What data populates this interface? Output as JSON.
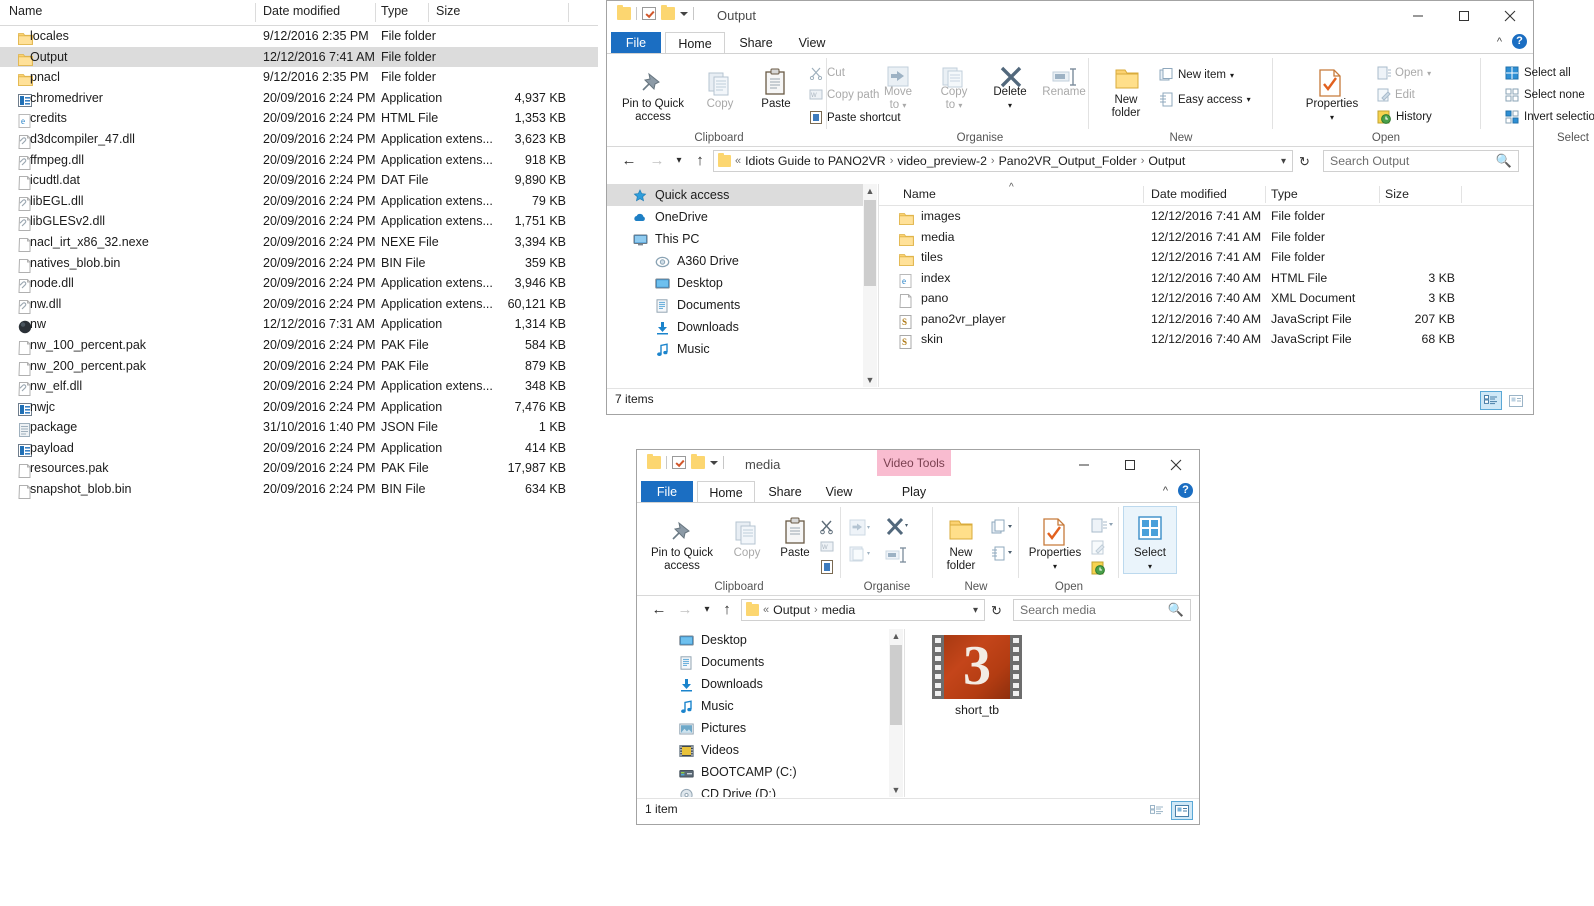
{
  "background_list": {
    "columns": [
      "Name",
      "Date modified",
      "Type",
      "Size"
    ],
    "rows": [
      {
        "icon": "folder-icon",
        "name": "locales",
        "date": "9/12/2016 2:35 PM",
        "type": "File folder",
        "size": "",
        "selected": false
      },
      {
        "icon": "folder-icon",
        "name": "Output",
        "date": "12/12/2016 7:41 AM",
        "type": "File folder",
        "size": "",
        "selected": true
      },
      {
        "icon": "folder-icon",
        "name": "pnacl",
        "date": "9/12/2016 2:35 PM",
        "type": "File folder",
        "size": "",
        "selected": false
      },
      {
        "icon": "application-icon",
        "name": "chromedriver",
        "date": "20/09/2016 2:24 PM",
        "type": "Application",
        "size": "4,937 KB",
        "selected": false
      },
      {
        "icon": "html-file-icon",
        "name": "credits",
        "date": "20/09/2016 2:24 PM",
        "type": "HTML File",
        "size": "1,353 KB",
        "selected": false
      },
      {
        "icon": "dll-icon",
        "name": "d3dcompiler_47.dll",
        "date": "20/09/2016 2:24 PM",
        "type": "Application extens...",
        "size": "3,623 KB",
        "selected": false
      },
      {
        "icon": "dll-icon",
        "name": "ffmpeg.dll",
        "date": "20/09/2016 2:24 PM",
        "type": "Application extens...",
        "size": "918 KB",
        "selected": false
      },
      {
        "icon": "generic-file-icon",
        "name": "icudtl.dat",
        "date": "20/09/2016 2:24 PM",
        "type": "DAT File",
        "size": "9,890 KB",
        "selected": false
      },
      {
        "icon": "dll-icon",
        "name": "libEGL.dll",
        "date": "20/09/2016 2:24 PM",
        "type": "Application extens...",
        "size": "79 KB",
        "selected": false
      },
      {
        "icon": "dll-icon",
        "name": "libGLESv2.dll",
        "date": "20/09/2016 2:24 PM",
        "type": "Application extens...",
        "size": "1,751 KB",
        "selected": false
      },
      {
        "icon": "generic-file-icon",
        "name": "nacl_irt_x86_32.nexe",
        "date": "20/09/2016 2:24 PM",
        "type": "NEXE File",
        "size": "3,394 KB",
        "selected": false
      },
      {
        "icon": "generic-file-icon",
        "name": "natives_blob.bin",
        "date": "20/09/2016 2:24 PM",
        "type": "BIN File",
        "size": "359 KB",
        "selected": false
      },
      {
        "icon": "dll-icon",
        "name": "node.dll",
        "date": "20/09/2016 2:24 PM",
        "type": "Application extens...",
        "size": "3,946 KB",
        "selected": false
      },
      {
        "icon": "dll-icon",
        "name": "nw.dll",
        "date": "20/09/2016 2:24 PM",
        "type": "Application extens...",
        "size": "60,121 KB",
        "selected": false
      },
      {
        "icon": "nw-app-icon",
        "name": "nw",
        "date": "12/12/2016 7:31 AM",
        "type": "Application",
        "size": "1,314 KB",
        "selected": false
      },
      {
        "icon": "generic-file-icon",
        "name": "nw_100_percent.pak",
        "date": "20/09/2016 2:24 PM",
        "type": "PAK File",
        "size": "584 KB",
        "selected": false
      },
      {
        "icon": "generic-file-icon",
        "name": "nw_200_percent.pak",
        "date": "20/09/2016 2:24 PM",
        "type": "PAK File",
        "size": "879 KB",
        "selected": false
      },
      {
        "icon": "dll-icon",
        "name": "nw_elf.dll",
        "date": "20/09/2016 2:24 PM",
        "type": "Application extens...",
        "size": "348 KB",
        "selected": false
      },
      {
        "icon": "application-icon",
        "name": "nwjc",
        "date": "20/09/2016 2:24 PM",
        "type": "Application",
        "size": "7,476 KB",
        "selected": false
      },
      {
        "icon": "json-file-icon",
        "name": "package",
        "date": "31/10/2016 1:40 PM",
        "type": "JSON File",
        "size": "1 KB",
        "selected": false
      },
      {
        "icon": "application-icon",
        "name": "payload",
        "date": "20/09/2016 2:24 PM",
        "type": "Application",
        "size": "414 KB",
        "selected": false
      },
      {
        "icon": "generic-file-icon",
        "name": "resources.pak",
        "date": "20/09/2016 2:24 PM",
        "type": "PAK File",
        "size": "17,987 KB",
        "selected": false
      },
      {
        "icon": "generic-file-icon",
        "name": "snapshot_blob.bin",
        "date": "20/09/2016 2:24 PM",
        "type": "BIN File",
        "size": "634 KB",
        "selected": false
      }
    ]
  },
  "window_output": {
    "title": "Output",
    "tabs": [
      {
        "id": "file",
        "label": "File"
      },
      {
        "id": "home",
        "label": "Home"
      },
      {
        "id": "share",
        "label": "Share"
      },
      {
        "id": "view",
        "label": "View"
      }
    ],
    "window_controls": {
      "minimize": "minimize-icon",
      "maximize": "maximize-icon",
      "close": "close-icon"
    },
    "ribbon": {
      "groups": [
        {
          "label": "Clipboard",
          "big": [
            {
              "label": "Pin to Quick\naccess",
              "line1": "Pin to Quick",
              "line2": "access",
              "dim": false
            },
            {
              "label": "Copy",
              "line1": "Copy",
              "line2": "",
              "dim": true
            },
            {
              "label": "Paste",
              "line1": "Paste",
              "line2": "",
              "dim": false
            }
          ],
          "small": [
            {
              "label": "Cut",
              "dim": true
            },
            {
              "label": "Copy path",
              "dim": true
            },
            {
              "label": "Paste shortcut",
              "dim": false
            }
          ]
        },
        {
          "label": "Organise",
          "big": [
            {
              "label": "Move to",
              "line1": "Move",
              "line2": "to",
              "dim": true
            },
            {
              "label": "Copy to",
              "line1": "Copy",
              "line2": "to",
              "dim": true
            },
            {
              "label": "Delete",
              "line1": "Delete",
              "line2": "",
              "dim": false
            },
            {
              "label": "Rename",
              "line1": "Rename",
              "line2": "",
              "dim": true
            }
          ],
          "small": []
        },
        {
          "label": "New",
          "big": [
            {
              "label": "New folder",
              "line1": "New",
              "line2": "folder",
              "dim": false
            }
          ],
          "small": [
            {
              "label": "New item",
              "dim": false
            },
            {
              "label": "Easy access",
              "dim": false
            }
          ]
        },
        {
          "label": "Open",
          "big": [
            {
              "label": "Properties",
              "line1": "Properties",
              "line2": "",
              "dim": false
            }
          ],
          "small": [
            {
              "label": "Open",
              "dim": true
            },
            {
              "label": "Edit",
              "dim": true
            },
            {
              "label": "History",
              "dim": false
            }
          ]
        },
        {
          "label": "Select",
          "big": [],
          "small": [
            {
              "label": "Select all",
              "dim": false
            },
            {
              "label": "Select none",
              "dim": false
            },
            {
              "label": "Invert selection",
              "dim": false
            }
          ]
        }
      ]
    },
    "address": {
      "breadcrumb": [
        "Idiots Guide to PANO2VR",
        "video_preview-2",
        "Pano2VR_Output_Folder",
        "Output"
      ],
      "prefix": "«",
      "search_placeholder": "Search Output"
    },
    "nav_pane": [
      {
        "label": "Quick access",
        "icon": "star-pin-icon",
        "indent": 0,
        "selected": true
      },
      {
        "label": "OneDrive",
        "icon": "cloud-icon",
        "indent": 0,
        "selected": false
      },
      {
        "label": "This PC",
        "icon": "monitor-icon",
        "indent": 0,
        "selected": false
      },
      {
        "label": "A360 Drive",
        "icon": "a360-icon",
        "indent": 1,
        "selected": false
      },
      {
        "label": "Desktop",
        "icon": "desktop-icon",
        "indent": 1,
        "selected": false
      },
      {
        "label": "Documents",
        "icon": "documents-icon",
        "indent": 1,
        "selected": false
      },
      {
        "label": "Downloads",
        "icon": "downloads-icon",
        "indent": 1,
        "selected": false
      },
      {
        "label": "Music",
        "icon": "music-icon",
        "indent": 1,
        "selected": false
      }
    ],
    "columns": [
      "Name",
      "Date modified",
      "Type",
      "Size"
    ],
    "files": [
      {
        "icon": "folder-icon",
        "name": "images",
        "date": "12/12/2016 7:41 AM",
        "type": "File folder",
        "size": ""
      },
      {
        "icon": "folder-icon",
        "name": "media",
        "date": "12/12/2016 7:41 AM",
        "type": "File folder",
        "size": ""
      },
      {
        "icon": "folder-icon",
        "name": "tiles",
        "date": "12/12/2016 7:41 AM",
        "type": "File folder",
        "size": ""
      },
      {
        "icon": "html-file-icon",
        "name": "index",
        "date": "12/12/2016 7:40 AM",
        "type": "HTML File",
        "size": "3 KB"
      },
      {
        "icon": "xml-file-icon",
        "name": "pano",
        "date": "12/12/2016 7:40 AM",
        "type": "XML Document",
        "size": "3 KB"
      },
      {
        "icon": "javascript-file-icon",
        "name": "pano2vr_player",
        "date": "12/12/2016 7:40 AM",
        "type": "JavaScript File",
        "size": "207 KB"
      },
      {
        "icon": "javascript-file-icon",
        "name": "skin",
        "date": "12/12/2016 7:40 AM",
        "type": "JavaScript File",
        "size": "68 KB"
      }
    ],
    "status": "7 items",
    "view_buttons": [
      {
        "name": "details-view",
        "active": true
      },
      {
        "name": "large-icons-view",
        "active": false
      }
    ]
  },
  "window_media": {
    "title": "media",
    "contextual_tab_header": "Video Tools",
    "tabs": [
      {
        "id": "file",
        "label": "File"
      },
      {
        "id": "home",
        "label": "Home"
      },
      {
        "id": "share",
        "label": "Share"
      },
      {
        "id": "view",
        "label": "View"
      },
      {
        "id": "play",
        "label": "Play"
      }
    ],
    "window_controls": {
      "minimize": "minimize-icon",
      "maximize": "maximize-icon",
      "close": "close-icon"
    },
    "ribbon": {
      "groups": [
        {
          "label": "Clipboard",
          "items": [
            "Pin to Quick access",
            "Copy",
            "Paste"
          ]
        },
        {
          "label": "Organise",
          "items": []
        },
        {
          "label": "New",
          "items": [
            "New folder"
          ]
        },
        {
          "label": "Open",
          "items": [
            "Properties"
          ]
        },
        {
          "label": "Select",
          "items": [
            "Select"
          ]
        }
      ],
      "labels": {
        "pin": "Pin to Quick",
        "pin2": "access",
        "copy": "Copy",
        "paste": "Paste",
        "new_folder_1": "New",
        "new_folder_2": "folder",
        "properties": "Properties",
        "select": "Select"
      }
    },
    "address": {
      "breadcrumb": [
        "Output",
        "media"
      ],
      "prefix": "«",
      "search_placeholder": "Search media"
    },
    "nav_pane": [
      {
        "label": "Desktop",
        "icon": "desktop-icon"
      },
      {
        "label": "Documents",
        "icon": "documents-icon"
      },
      {
        "label": "Downloads",
        "icon": "downloads-icon"
      },
      {
        "label": "Music",
        "icon": "music-icon"
      },
      {
        "label": "Pictures",
        "icon": "pictures-icon"
      },
      {
        "label": "Videos",
        "icon": "videos-icon"
      },
      {
        "label": "BOOTCAMP (C:)",
        "icon": "drive-icon"
      },
      {
        "label": "CD Drive (D:)",
        "icon": "cd-drive-icon"
      }
    ],
    "items": [
      {
        "name": "short_tb",
        "thumbnail": "video-thumbnail-3",
        "type": "video"
      }
    ],
    "status": "1 item",
    "view_buttons": [
      {
        "name": "details-view",
        "active": false
      },
      {
        "name": "large-icons-view",
        "active": true
      }
    ]
  },
  "colors": {
    "accent_blue": "#1b6ec2",
    "folder_yellow": "#fcd670",
    "selection_gray": "#dcdcdc",
    "contextual_pink": "#f9bcd0",
    "video_orange": "#c4451a"
  }
}
